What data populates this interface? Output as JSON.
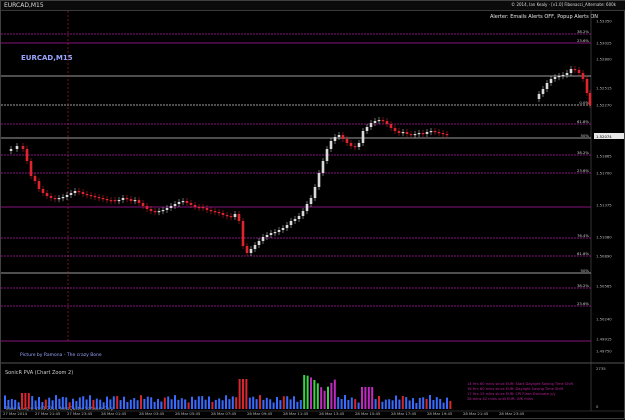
{
  "window": {
    "title": "EURCAD,M15",
    "top_right_text": "© 2014, Ian Kealy · [v1.0] Fibonacci_Alternate: 600k"
  },
  "alerts_text": "Alerter:  Emails Alerts OFF,  Popup Alerts ON",
  "chart_name": "EURCAD,M15",
  "credit": "Picture by Ramona - The crazy Bone",
  "indicator": {
    "name": "SonicR PVA  (Chart Zoom 2)",
    "scale_top": "2735",
    "scale_bottom": "0"
  },
  "copyright": "Trade Navig  © 2001-2014, MetaQuotes Software Corp.",
  "events": [
    "14 Hrs 60 mins since EUR: Start Daylight Saving Time Shift",
    "16 Hrs 60 mins since EUR: Daylight Saving Time Shift",
    "17 Hrs 15 mins since EUR: CPI Flash Estimate y/y",
    "26 mins 42 mins until EUR: GfK mins"
  ],
  "price_axis": [
    "1.53350",
    "1.53025",
    "1.52800",
    "1.52515",
    "1.52270",
    "1.52074",
    "1.51865",
    "1.51700",
    "1.51375",
    "1.51080",
    "1.50890",
    "1.50565",
    "1.50240",
    "1.49915",
    "1.49750"
  ],
  "current_price": "1.52074",
  "fib_labels": [
    "38.2%",
    "23.6%",
    "0.0%",
    "61.8%",
    "50%",
    "38.2%",
    "23.6%",
    "76.4%",
    "61.8%",
    "50%",
    "38.2%",
    "23.6%"
  ],
  "time_axis": [
    "27 Mar 2014",
    "27 Mar 21:45",
    "27 Mar 23:45",
    "28 Mar 01:45",
    "28 Mar 03:45",
    "28 Mar 05:45",
    "28 Mar 07:45",
    "28 Mar 09:45",
    "28 Mar 11:45",
    "28 Mar 13:45",
    "28 Mar 15:45",
    "28 Mar 17:45",
    "28 Mar 19:45",
    "28 Mar 21:45",
    "28 Mar 23:45"
  ],
  "colors": {
    "bull": "#d9d9d9",
    "bear": "#e0242e",
    "fib_magenta": "#b01da8",
    "fib_white": "#cfcfcf",
    "volume_green": "#3fd14a",
    "volume_blue": "#3a6bff",
    "volume_magenta": "#c02ac0",
    "volume_red": "#d8262e"
  }
}
